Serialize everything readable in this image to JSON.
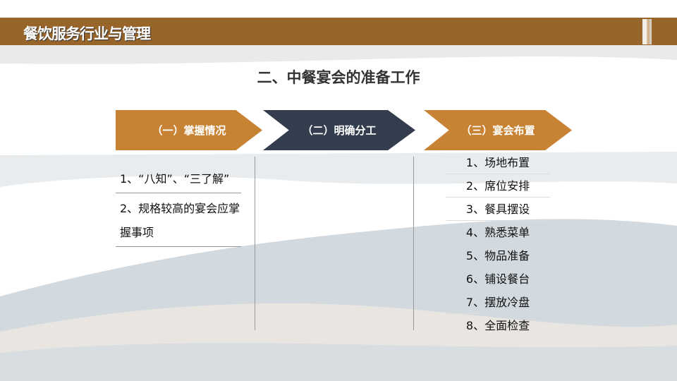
{
  "header": {
    "title": "餐饮服务行业与管理"
  },
  "subtitle": "二、中餐宴会的准备工作",
  "steps": [
    {
      "label": "（一）掌握情况"
    },
    {
      "label": "（二）明确分工"
    },
    {
      "label": "（三）宴会布置"
    }
  ],
  "left_items": [
    "1、“八知”、“三了解”",
    "2、规格较高的宴会应掌握事项"
  ],
  "right_items": [
    "1、场地布置",
    "2、席位安排",
    "3、餐具摆设",
    "4、熟悉菜单",
    "5、物品准备",
    "6、铺设餐台",
    "7、摆放冷盘",
    "8、全面检查"
  ]
}
